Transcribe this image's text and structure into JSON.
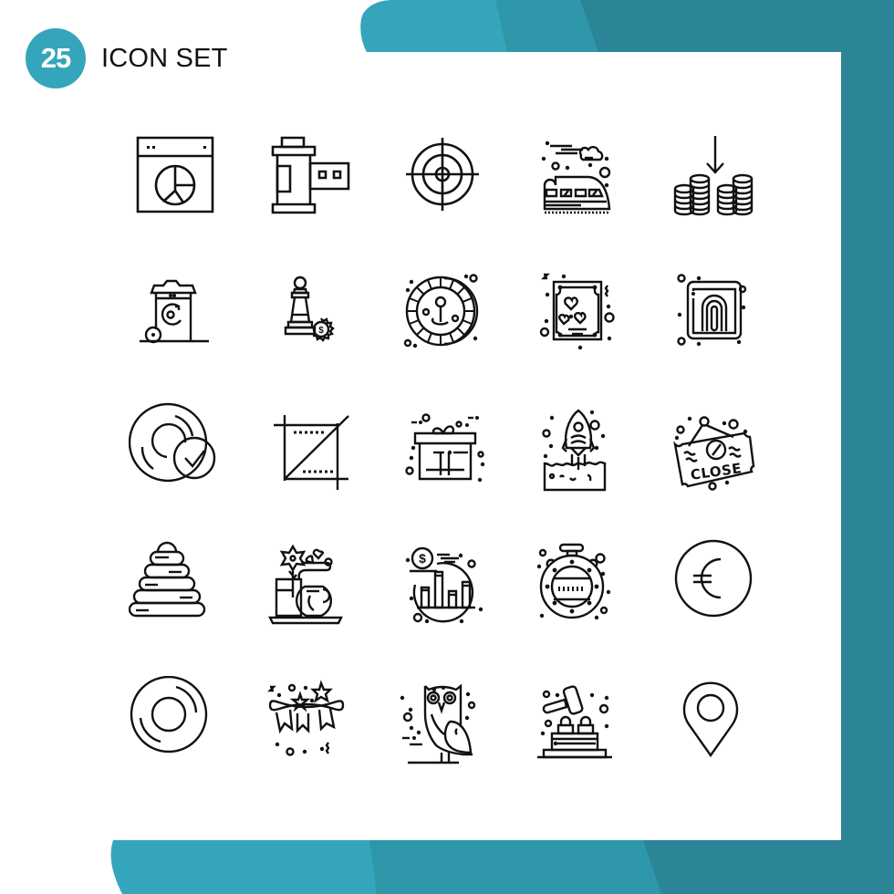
{
  "header": {
    "count": "25",
    "title": "ICON SET"
  },
  "colors": {
    "teal_light": "#35a5bb",
    "teal_mid": "#2e97aa",
    "teal_dark": "#2b8597",
    "icon_stroke": "#111111",
    "card": "#ffffff"
  },
  "icons": [
    {
      "name": "browser-pie-chart-icon"
    },
    {
      "name": "camera-film-roll-icon"
    },
    {
      "name": "target-crosshair-icon"
    },
    {
      "name": "bullet-train-icon"
    },
    {
      "name": "coins-arrow-down-icon"
    },
    {
      "name": "recycle-bin-icon"
    },
    {
      "name": "chess-pawn-gear-dollar-icon"
    },
    {
      "name": "roulette-wheel-icon"
    },
    {
      "name": "love-card-hearts-icon"
    },
    {
      "name": "fingerprint-icon"
    },
    {
      "name": "disc-check-icon"
    },
    {
      "name": "crop-tool-icon"
    },
    {
      "name": "gift-box-icon"
    },
    {
      "name": "rocket-launch-icon"
    },
    {
      "name": "close-sign-coffee-icon"
    },
    {
      "name": "stacking-rings-toy-icon"
    },
    {
      "name": "flower-tea-cup-icon"
    },
    {
      "name": "dollar-bar-chart-icon"
    },
    {
      "name": "porthole-icon"
    },
    {
      "name": "euro-coin-icon"
    },
    {
      "name": "vinyl-disc-icon"
    },
    {
      "name": "party-bunting-stars-icon"
    },
    {
      "name": "owl-icon"
    },
    {
      "name": "hammer-blocks-icon"
    },
    {
      "name": "map-pin-icon"
    }
  ],
  "labels": {
    "close_sign_text": "CLOSE",
    "dollar_symbol": "$"
  }
}
